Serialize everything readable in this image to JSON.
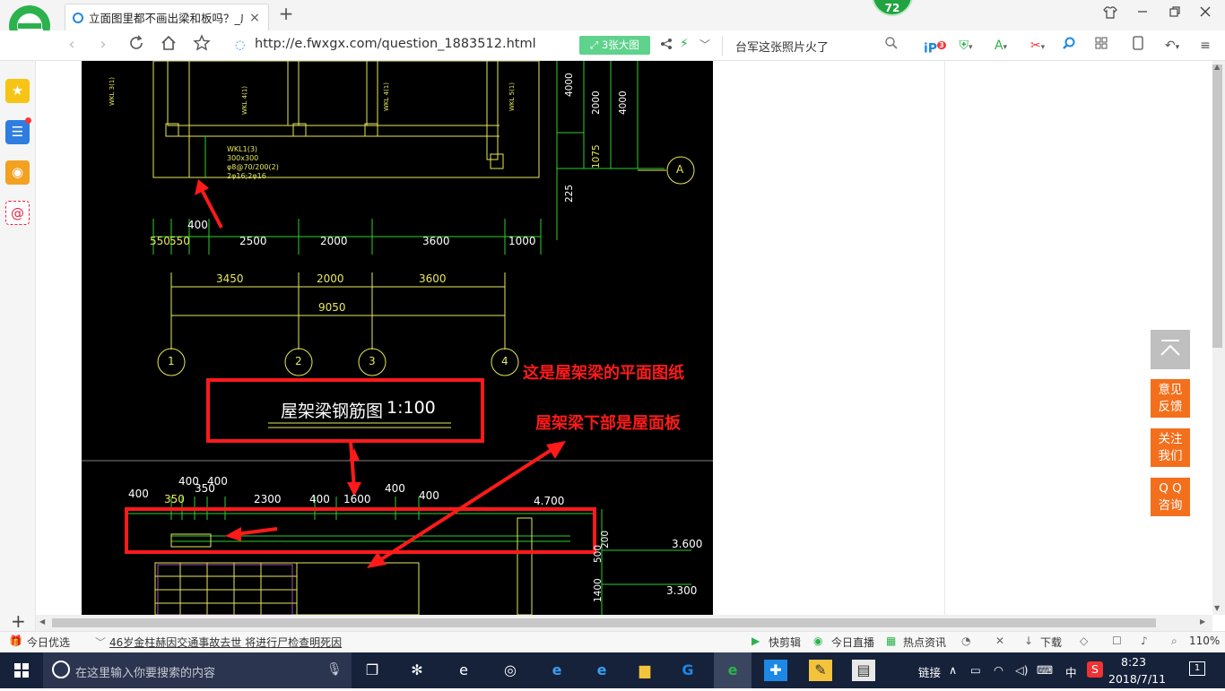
{
  "browser": {
    "tab_title": "立面图里都不画出梁和板吗？_广联达",
    "tab_close": "×",
    "new_tab": "+",
    "badge_count": "72",
    "address": "http://e.fwxgx.com/question_1883512.html",
    "big_image_button": "3张大图",
    "search_text": "台军这张照片火了",
    "ip_badge_count": "3"
  },
  "drawing": {
    "top_dims": [
      "550",
      "550",
      "2500",
      "2000",
      "3600",
      "1000"
    ],
    "dim_400_top": "400",
    "mid_dims": [
      "3450",
      "2000",
      "3600"
    ],
    "total_dim": "9050",
    "axis_labels": [
      "1",
      "2",
      "3",
      "4"
    ],
    "axis_a": "A",
    "right_dims": [
      "4000",
      "2000",
      "4000"
    ],
    "right_small": "1075",
    "right_bottom": "225",
    "beam_labels": [
      "WKL 3(1)",
      "WKL 4(1)",
      "WKL 4(1)",
      "WKL 5(1)"
    ],
    "beam_note": [
      "WKL1(3)",
      "300x300",
      "φ8@70/200(2)",
      "2φ16;2φ16"
    ],
    "plan_title": "屋架梁钢筋图",
    "plan_scale": "1:100",
    "annotation_1": "这是屋架梁的平面图纸",
    "annotation_2": "屋架梁下部是屋面板",
    "bottom_dims": [
      "400",
      "350",
      "400",
      "400",
      "350",
      "2300",
      "400",
      "1600",
      "400",
      "400"
    ],
    "elev_1": "3.600",
    "elev_2": "3.300",
    "small_dims": [
      "1400",
      "500",
      "200"
    ],
    "elev_top": "4.700"
  },
  "float_buttons": [
    "意见",
    "反馈",
    "关注",
    "我们",
    "Q Q",
    "咨询"
  ],
  "statusbar": {
    "today_pick": "今日优选",
    "news": "46岁金柱赫因交通事故去世 将进行尸检查明死因",
    "quick_clip": "快剪辑",
    "today_live": "今日直播",
    "hot_news": "热点资讯",
    "download": "下载",
    "zoom": "110%"
  },
  "taskbar": {
    "search_placeholder": "在这里输入你要搜索的内容",
    "link_label": "链接",
    "ime": "中",
    "time": "8:23",
    "date": "2018/7/11",
    "notify_count": "1"
  },
  "colors": {
    "accent_orange": "#f36f1c",
    "cad_yellow": "#e8e85c",
    "cad_green": "#2bd12b",
    "annotation_red": "#ff1a1a"
  }
}
